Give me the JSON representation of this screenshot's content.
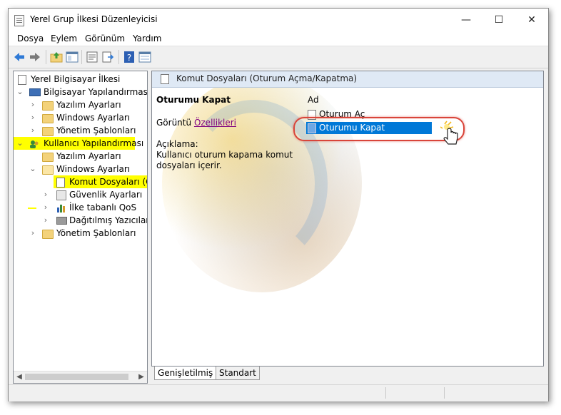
{
  "window": {
    "title": "Yerel Grup İlkesi Düzenleyicisi",
    "min_glyph": "—",
    "max_glyph": "☐",
    "close_glyph": "✕"
  },
  "menu": [
    "Dosya",
    "Eylem",
    "Görünüm",
    "Yardım"
  ],
  "toolbar": {
    "icons": [
      "back-arrow-icon",
      "forward-arrow-icon",
      "up-folder-icon",
      "show-hide-tree-icon",
      "properties-icon",
      "export-list-icon",
      "help-icon",
      "console-view-icon"
    ]
  },
  "tree": {
    "root": "Yerel Bilgisayar İlkesi",
    "computer_config": "Bilgisayar Yapılandırması",
    "software_settings_1": "Yazılım Ayarları",
    "windows_settings_1": "Windows Ayarları",
    "admin_templates_1": "Yönetim Şablonları",
    "user_config": "Kullanıcı Yapılandırması",
    "software_settings_2": "Yazılım Ayarları",
    "windows_settings_2": "Windows Ayarları",
    "scripts": "Komut Dosyaları (Ot",
    "security_settings": "Güvenlik Ayarları",
    "qos": "İlke tabanlı QoS",
    "printers": "Dağıtılmış Yazıcılar",
    "admin_templates_2": "Yönetim Şablonları"
  },
  "right": {
    "header": "Komut Dosyaları (Oturum Açma/Kapatma)",
    "item_title": "Oturumu Kapat",
    "display_prefix": "Görüntü",
    "display_link": "Özellikleri",
    "desc_label": "Açıklama:",
    "desc_text_1": "Kullanıcı oturum kapama komut",
    "desc_text_2": "dosyaları içerir.",
    "col_name": "Ad",
    "list": [
      "Oturum Aç",
      "Oturumu Kapat"
    ]
  },
  "tabs": [
    "Genişletilmiş",
    "Standart"
  ],
  "colors": {
    "highlight": "#ffff00",
    "selection": "#0078d7",
    "callout": "#d9453a",
    "link": "#800080"
  }
}
